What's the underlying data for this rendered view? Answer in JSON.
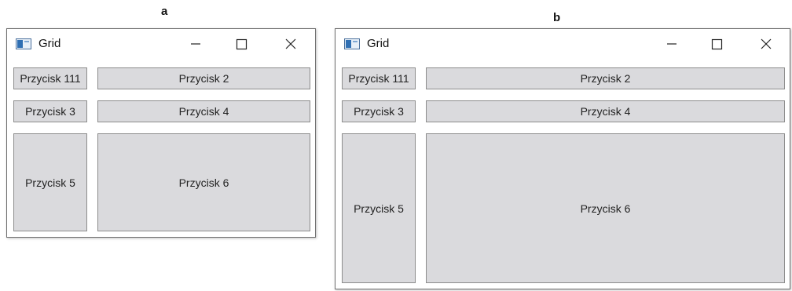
{
  "panels": [
    {
      "label": "a",
      "window": {
        "title": "Grid",
        "icon": "window-app-icon",
        "controls": [
          "minimize-icon",
          "maximize-icon",
          "close-icon"
        ],
        "buttons": [
          "Przycisk 111",
          "Przycisk 2",
          "Przycisk 3",
          "Przycisk 4",
          "Przycisk 5",
          "Przycisk 6"
        ]
      }
    },
    {
      "label": "b",
      "window": {
        "title": "Grid",
        "icon": "window-app-icon",
        "controls": [
          "minimize-icon",
          "maximize-icon",
          "close-icon"
        ],
        "buttons": [
          "Przycisk 111",
          "Przycisk 2",
          "Przycisk 3",
          "Przycisk 4",
          "Przycisk 5",
          "Przycisk 6"
        ]
      }
    }
  ],
  "colors": {
    "button_bg": "#dadadd",
    "button_border": "#8c8c8c",
    "window_border": "#6e6e6e"
  }
}
